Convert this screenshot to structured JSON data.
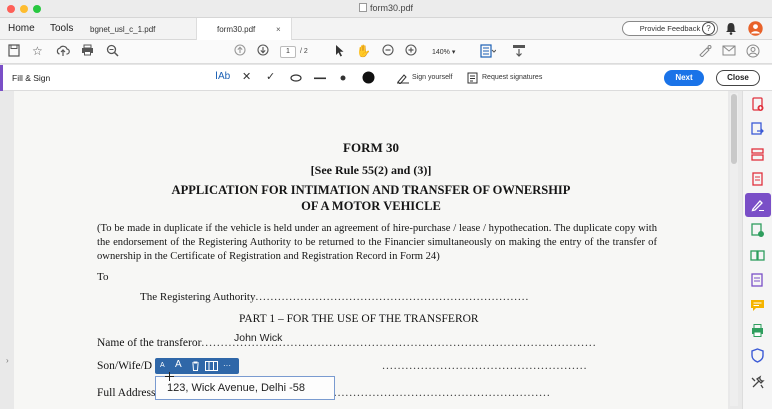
{
  "window": {
    "title": "form30.pdf",
    "traffic_colors": [
      "#fe5f57",
      "#febc2e",
      "#28c840"
    ]
  },
  "menu": {
    "home": "Home",
    "tools": "Tools"
  },
  "tabs": [
    {
      "label": "bgnet_usl_c_1.pdf",
      "close": ""
    },
    {
      "label": "form30.pdf",
      "close": "×"
    }
  ],
  "header": {
    "provide_feedback": "Provide Feedback",
    "help": "?"
  },
  "toolbar": {
    "page_current": "1",
    "page_total": "/ 2",
    "zoom": "140%"
  },
  "fill_sign": {
    "title": "Fill & Sign",
    "text_tool": "Ab",
    "sign_yourself": "Sign yourself",
    "request_signatures": "Request signatures",
    "next": "Next",
    "close": "Close",
    "accent": "#7a4fc7",
    "next_color": "#1a73e8"
  },
  "document": {
    "heading": "FORM 30",
    "rule": "[See Rule 55(2) and (3)]",
    "title_line1": "APPLICATION FOR INTIMATION AND TRANSFER OF OWNERSHIP",
    "title_line2": "OF A MOTOR VEHICLE",
    "paragraph": "(To be made in duplicate if the vehicle is held under an agreement of hire-purchase / lease / hypothecation. The duplicate copy with the endorsement of the Registering Authority to be returned to the Financier simultaneously on making the entry of the transfer of ownership in the Certificate of Registration and Registration Record in Form 24)",
    "to": "To",
    "authority": "The Registering Authority",
    "part1": "PART 1 – FOR THE USE OF THE TRANSFEROR",
    "name_label": "Name of the transferor",
    "son_label": "Son/Wife/D",
    "address_label": "Full Address"
  },
  "fields": {
    "transferor_name": "John Wick",
    "full_address": "123, Wick Avenue, Delhi -58"
  },
  "field_toolbar": {
    "small_a": "A",
    "large_a": "A",
    "more": "···"
  }
}
